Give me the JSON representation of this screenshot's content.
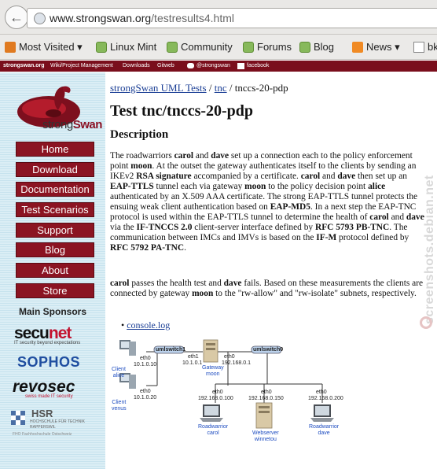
{
  "browser": {
    "url_host": "www.strongswan.org",
    "url_path": "/testresults4.html"
  },
  "bookmarks": [
    {
      "label": "Most Visited ▾",
      "icon": "star-icon"
    },
    {
      "label": "Linux Mint",
      "icon": "mint-icon"
    },
    {
      "label": "Community",
      "icon": "mint-icon"
    },
    {
      "label": "Forums",
      "icon": "mint-icon"
    },
    {
      "label": "Blog",
      "icon": "mint-icon"
    },
    {
      "label": "News ▾",
      "icon": "rss-icon"
    },
    {
      "label": "bk",
      "icon": "page-icon"
    }
  ],
  "site_topbar": {
    "links": [
      "strongswan.org",
      "Wiki/Project Management",
      "Downloads",
      "Gitweb"
    ],
    "twitter": "@strongswan",
    "facebook": "facebook"
  },
  "sidebar": {
    "logo_text_a": "strong",
    "logo_text_b": "Swan",
    "nav": [
      "Home",
      "Download",
      "Documentation",
      "Test Scenarios",
      "Support",
      "Blog",
      "About",
      "Store"
    ],
    "sponsors_heading": "Main Sponsors",
    "secunet_a": "secu",
    "secunet_b": "net",
    "secunet_tag": "IT security beyond expectations",
    "sophos": "SOPHOS",
    "revosec": "revosec",
    "revosec_tag": "swiss made IT security",
    "hsr": "HSR",
    "hsr_sub": "HOCHSCHULE FÜR TECHNIK RAPPERSWIL",
    "hsr_foot": "FHO Fachhochschule Ostschweiz"
  },
  "main": {
    "crumb_root": "strongSwan UML Tests",
    "crumb_sep1": " / ",
    "crumb_tnc": "tnc",
    "crumb_sep2": " / ",
    "crumb_current": "tnccs-20-pdp",
    "title": "Test tnc/tnccs-20-pdp",
    "description_heading": "Description",
    "console_link": "console.log"
  },
  "diagram": {
    "switch1": "umlswitch1",
    "switch0": "umlswitch0",
    "alice_eth": "eth0",
    "alice_ip": "10.1.0.10",
    "alice_label_1": "Client",
    "alice_label_2": "alice",
    "venus_eth": "eth0",
    "venus_ip": "10.1.0.20",
    "venus_label_1": "Client",
    "venus_label_2": "venus",
    "moon_eth1": "eth1",
    "moon_ip1": "10.1.0.1",
    "moon_eth0": "eth0",
    "moon_ip0": "192.168.0.1",
    "moon_label_1": "Gateway",
    "moon_label_2": "moon",
    "carol_eth": "eth0",
    "carol_ip": "192.168.0.100",
    "carol_label_1": "Roadwarrior",
    "carol_label_2": "carol",
    "winnetou_eth": "eth0",
    "winnetou_ip": "192.168.0.150",
    "winnetou_label_1": "Webserver",
    "winnetou_label_2": "winnetou",
    "dave_eth": "eth0",
    "dave_ip": "192.168.0.200",
    "dave_label_1": "Roadwarrior",
    "dave_label_2": "dave"
  },
  "watermark": "screenshots.debian.net",
  "colors": {
    "brand_red": "#8b1422",
    "link_blue": "#1a3e95",
    "sidebar_bg": "#dbeef5"
  }
}
